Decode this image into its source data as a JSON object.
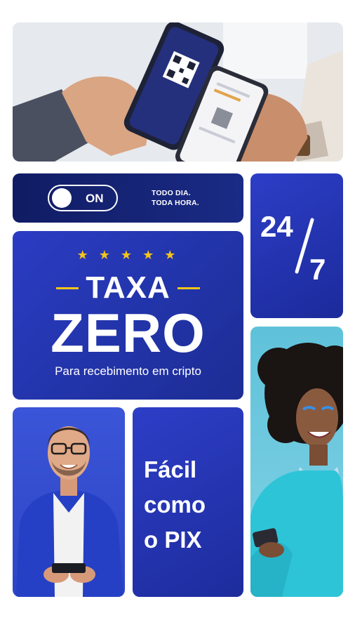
{
  "toggle": {
    "state_label": "ON",
    "line1": "TODO DIA.",
    "line2": "TODA HORA."
  },
  "badge": {
    "top": "24",
    "bottom": "7"
  },
  "promo": {
    "stars": "★ ★ ★ ★ ★",
    "title_line1": "TAXA",
    "title_line2": "ZERO",
    "subtitle": "Para recebimento em cripto"
  },
  "facil": {
    "line1": "Fácil",
    "line2": "como",
    "line3": "o PIX"
  },
  "colors": {
    "navy": "#101c63",
    "royal_blue": "#2b3cc4",
    "star_yellow": "#f5c518",
    "cyan": "#5fc2da"
  }
}
